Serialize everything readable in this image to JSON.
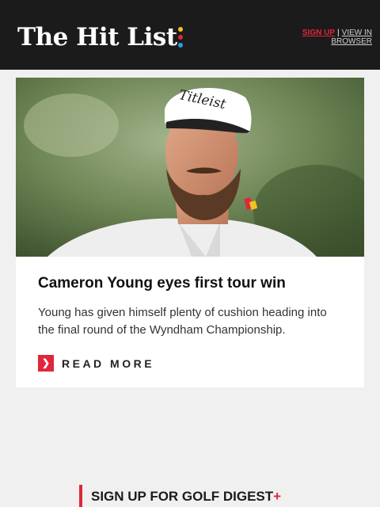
{
  "header": {
    "logo_text": "The Hit List",
    "logo_dot_colors": [
      "#f4c21c",
      "#e0263b",
      "#2a9fd8"
    ],
    "signup_link": "SIGN UP",
    "separator": "|",
    "view_in_browser_link": "VIEW IN BROWSER"
  },
  "article": {
    "image_description_icon": "golfer-photo",
    "headline": "Cameron Young eyes first tour win",
    "dek": "Young has given himself plenty of cushion heading into the final round of the Wyndham Championship.",
    "read_more_label": "READ MORE",
    "read_more_icon": "chevron-right-icon"
  },
  "signup_promo": {
    "title": "SIGN UP FOR GOLF DIGEST",
    "plus": "+"
  },
  "colors": {
    "header_bg": "#1b1b1b",
    "accent_red": "#e0263b",
    "page_bg": "#f0f0f0",
    "signup_link": "#e0263b"
  }
}
